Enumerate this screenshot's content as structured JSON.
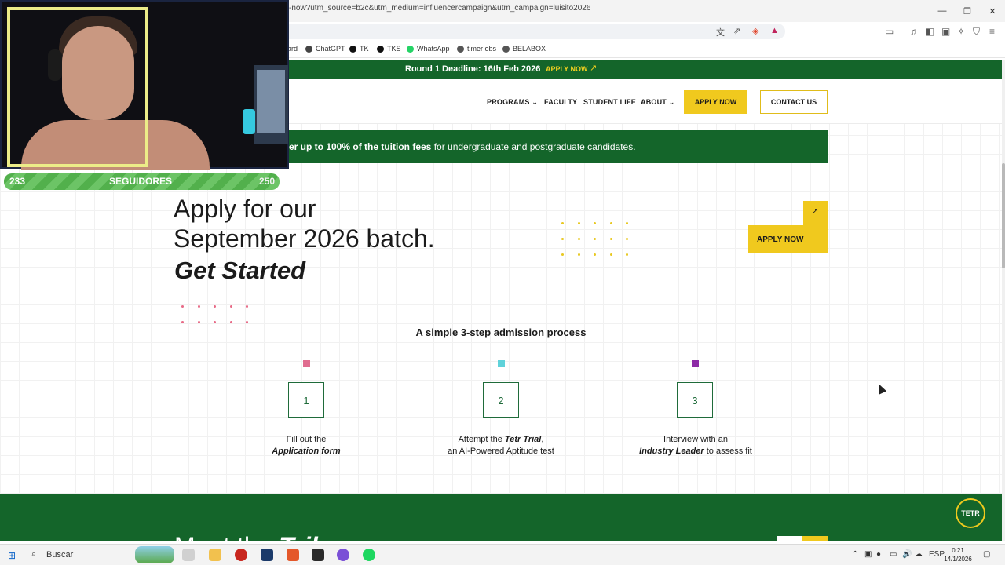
{
  "browser": {
    "url": "-now?utm_source=b2c&utm_medium=influencercampaign&utm_campaign=luisito2026",
    "bookmarks": [
      "ard",
      "ChatGPT",
      "TK",
      "TKS",
      "WhatsApp",
      "timer obs",
      "BELABOX"
    ]
  },
  "banner": {
    "deadline": "Round 1 Deadline: 16th Feb 2026",
    "apply_link": "APPLY NOW",
    "arrow": "↗"
  },
  "nav": {
    "items": [
      "PROGRAMS",
      "FACULTY",
      "STUDENT LIFE",
      "ABOUT"
    ],
    "chevron": "⌄",
    "apply": "APPLY NOW",
    "contact": "CONTACT US"
  },
  "scholarship": {
    "bold": "er up to 100% of the tuition fees",
    "rest": " for undergraduate and postgraduate candidates."
  },
  "hero": {
    "line1": "Apply for our",
    "line2": "September 2026 batch.",
    "emphasis": "Get Started",
    "apply_card": "APPLY NOW",
    "apply_arrow": "↗"
  },
  "process": {
    "title": "A simple 3-step admission process",
    "steps": [
      {
        "number": "1",
        "line1": "Fill out the",
        "line2_bold": "Application form",
        "line2_rest": "",
        "marker_color": "#e06c8f"
      },
      {
        "number": "2",
        "line1_plain": "Attempt the ",
        "line1_bold": "Tetr Trial",
        "line1_end": ",",
        "line2": "an AI-Powered Aptitude test",
        "marker_color": "#5fd2da"
      },
      {
        "number": "3",
        "line1": "Interview with an",
        "line2_bold": "Industry Leader",
        "line2_rest": " to assess fit",
        "marker_color": "#8d2aa6"
      }
    ]
  },
  "tribe": {
    "title_plain": "Meet the ",
    "title_em": "Tribe",
    "badge": "TETR"
  },
  "stream": {
    "followers_current": "233",
    "followers_label": "SEGUIDORES",
    "followers_goal": "250"
  },
  "taskbar": {
    "search": "Buscar",
    "language": "ESP",
    "time": "0:21",
    "date": "14/1/2026"
  },
  "colors": {
    "brand_green": "#14652a",
    "accent_yellow": "#f0c91e"
  }
}
